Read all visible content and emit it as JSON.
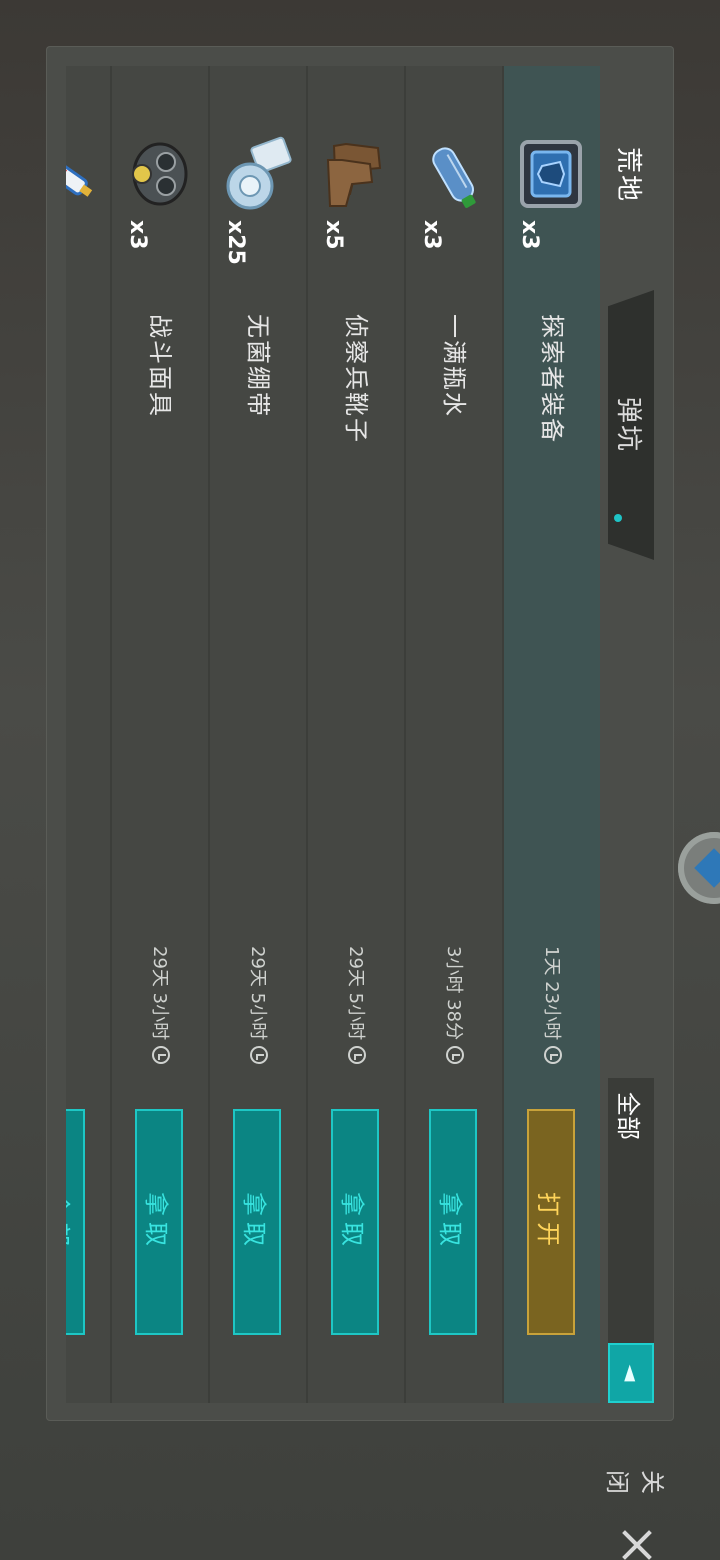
{
  "tabs": [
    {
      "label": "荒地",
      "active": true
    },
    {
      "label": "弹坑",
      "active": false,
      "has_new": true
    }
  ],
  "filter": {
    "label": "全部",
    "arrow": "◄"
  },
  "items": [
    {
      "icon": "explorer-kit-icon",
      "qty": "x3",
      "name": "探索者装备",
      "timer": "1天 23小时",
      "action": "打开",
      "highlight": true
    },
    {
      "icon": "water-bottle-icon",
      "qty": "x3",
      "name": "一满瓶水",
      "timer": "3小时 38分",
      "action": "拿取",
      "highlight": false
    },
    {
      "icon": "scout-boots-icon",
      "qty": "x5",
      "name": "侦察兵靴子",
      "timer": "29天 5小时",
      "action": "拿取",
      "highlight": false
    },
    {
      "icon": "sterile-bandage-icon",
      "qty": "x25",
      "name": "无菌绷带",
      "timer": "29天 5小时",
      "action": "拿取",
      "highlight": false
    },
    {
      "icon": "combat-mask-icon",
      "qty": "x3",
      "name": "战斗面具",
      "timer": "29天 3小时",
      "action": "拿取",
      "highlight": false
    },
    {
      "icon": "syringe-icon",
      "qty": "",
      "name": "…",
      "timer": "…",
      "action": "全部",
      "highlight": false
    }
  ],
  "close": {
    "label": "关闭"
  },
  "colors": {
    "accent": "#1ec7c5",
    "open_button": "#7a6420",
    "highlight_row": "#3f5453"
  }
}
